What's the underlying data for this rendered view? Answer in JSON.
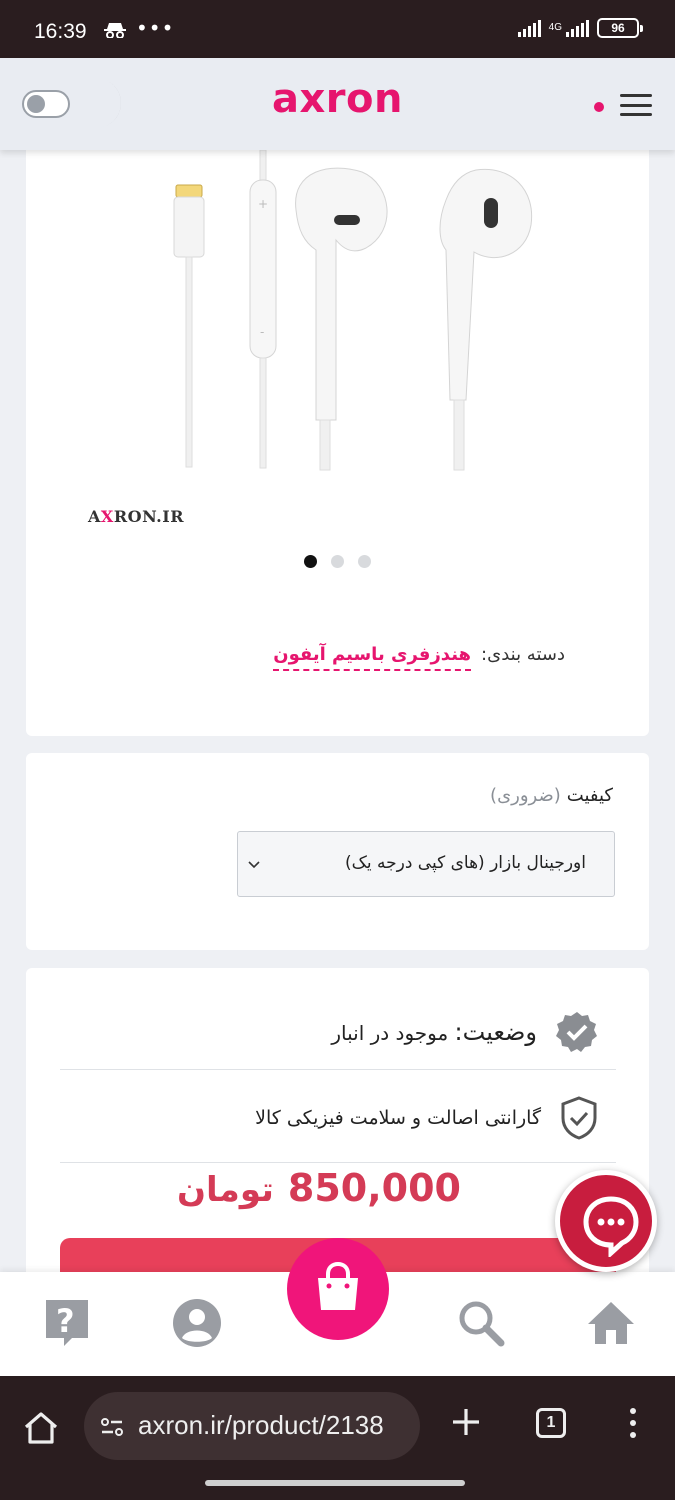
{
  "status_bar": {
    "time": "16:39",
    "more": "•••",
    "network": "4G",
    "battery": "96"
  },
  "header": {
    "logo": "axron"
  },
  "product": {
    "watermark_prefix": "A",
    "watermark_x": "X",
    "watermark_rest": "RON.IR",
    "category_label": "دسته بندی:",
    "category_value": "هندزفری باسیم آیفون",
    "carousel_total": 3,
    "carousel_active": 1
  },
  "quality": {
    "label": "کیفیت",
    "required": "(ضروری)",
    "selected": "اورجینال بازار (های کپی درجه یک)"
  },
  "stock": {
    "status_label": "وضعیت:",
    "status_value": "موجود در انبار",
    "guarantee": "گارانتی اصالت و سلامت فیزیکی کالا",
    "price": "850,000",
    "currency": "تومان"
  },
  "browser": {
    "url": "axron.ir/product/2138",
    "tab_count": "1"
  },
  "colors": {
    "brand": "#e6156e",
    "price": "#d43b56",
    "chat": "#c81d3e"
  },
  "icons": [
    "incognito-icon",
    "moon-icon",
    "menu-icon",
    "verified-icon",
    "shield-icon",
    "chat-icon",
    "help-icon",
    "account-icon",
    "cart-icon",
    "search-icon",
    "home-icon"
  ]
}
